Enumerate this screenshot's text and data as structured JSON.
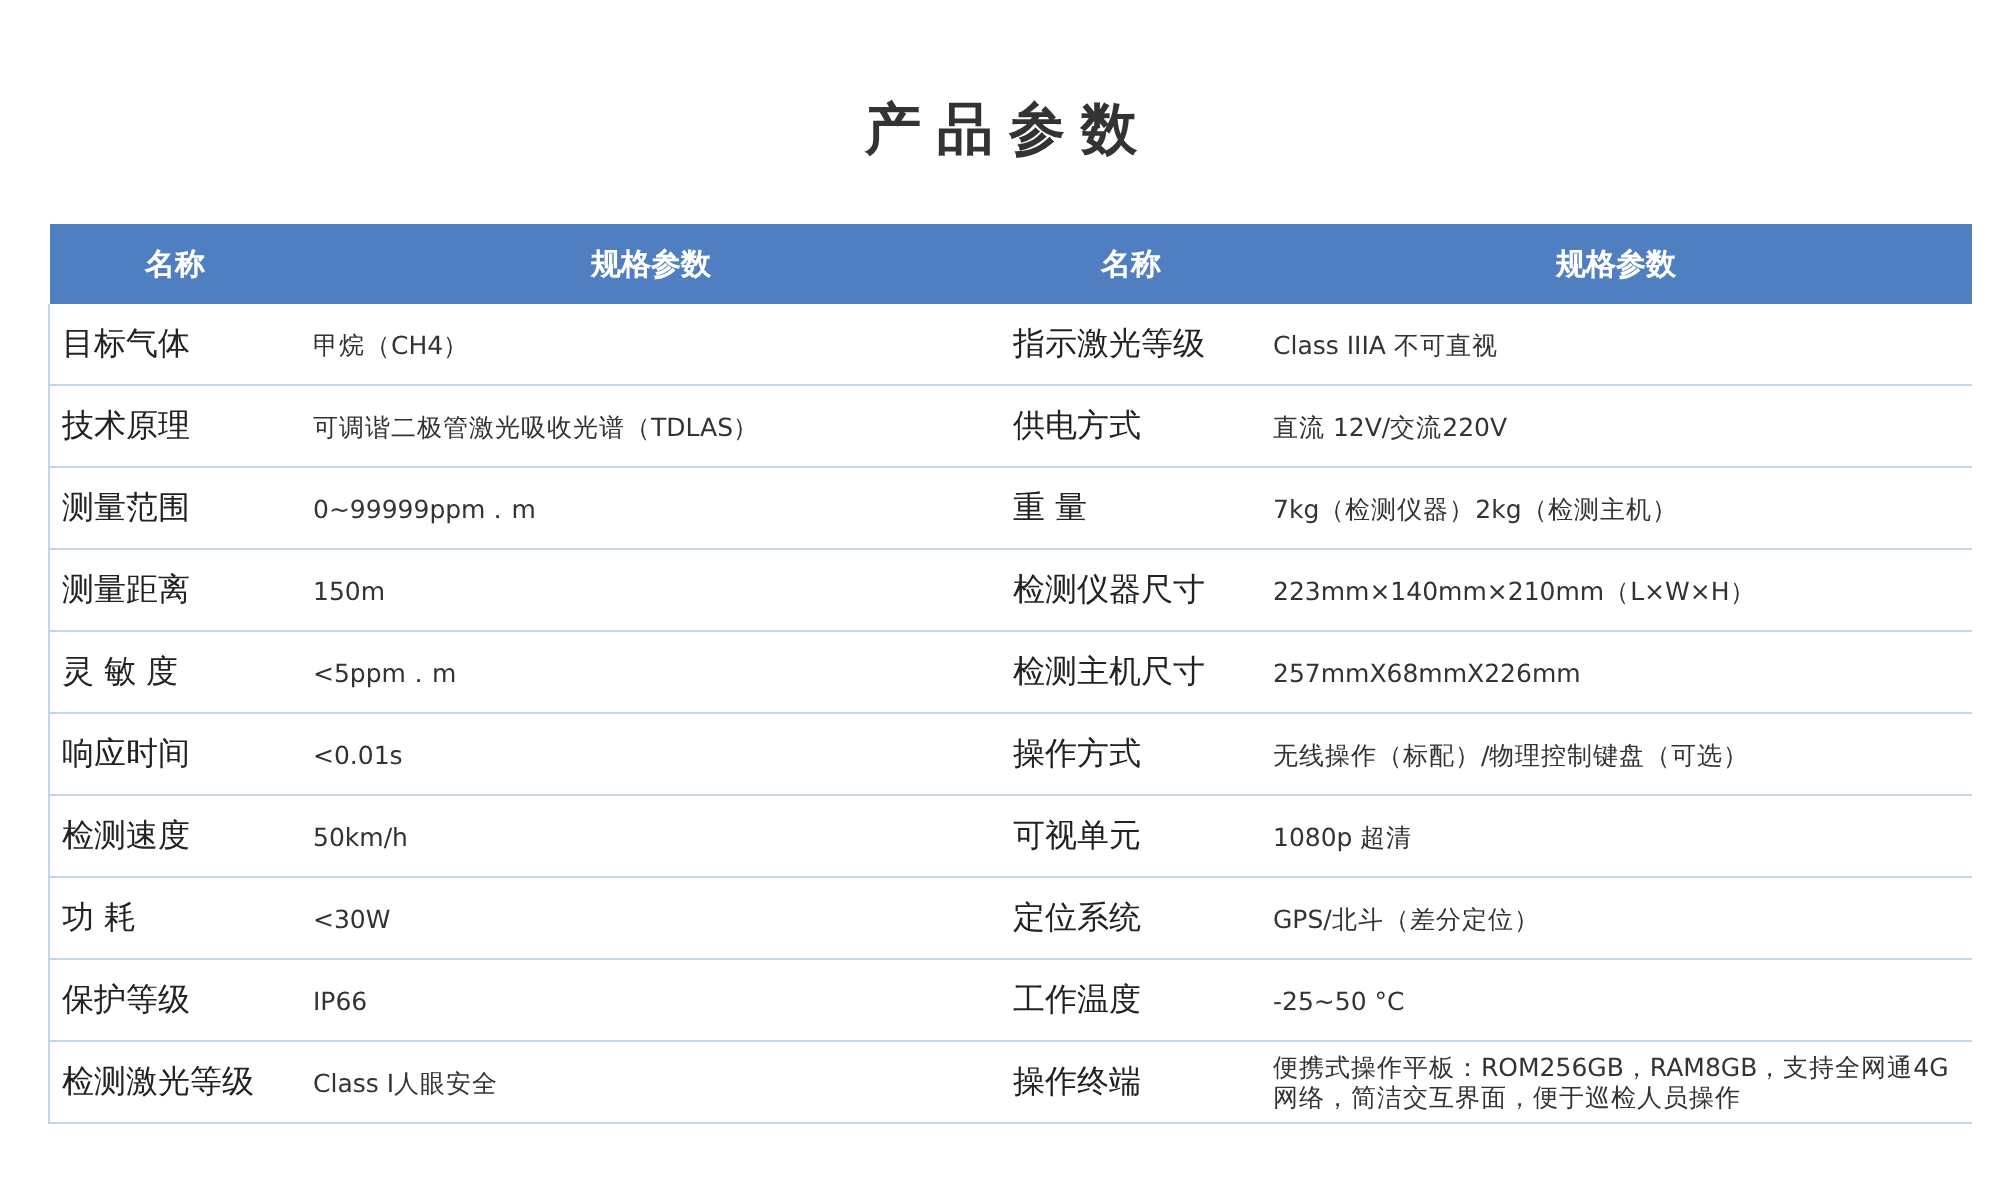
{
  "title": "产品参数",
  "columns": [
    "名称",
    "规格参数",
    "名称",
    "规格参数"
  ],
  "rows": [
    {
      "cells": [
        "目标气体",
        "甲烷（CH4）",
        "指示激光等级",
        "Class IIIA 不可直视"
      ]
    },
    {
      "cells": [
        "技术原理",
        "可调谐二极管激光吸收光谱（TDLAS）",
        "供电方式",
        "直流 12V/交流220V"
      ]
    },
    {
      "cells": [
        "测量范围",
        "0~99999ppm．m",
        "重 量",
        "7kg（检测仪器）2kg（检测主机）"
      ]
    },
    {
      "cells": [
        "测量距离",
        "150m",
        "检测仪器尺寸",
        "223mm×140mm×210mm（L×W×H）"
      ]
    },
    {
      "cells": [
        "灵 敏 度",
        "<5ppm．m",
        "检测主机尺寸",
        "257mmX68mmX226mm"
      ]
    },
    {
      "cells": [
        "响应时间",
        "<0.01s",
        "操作方式",
        "无线操作（标配）/物理控制键盘（可选）"
      ]
    },
    {
      "cells": [
        "检测速度",
        "50km/h",
        "可视单元",
        "1080p 超清"
      ]
    },
    {
      "cells": [
        "功 耗",
        "<30W",
        "定位系统",
        "GPS/北斗（差分定位）"
      ]
    },
    {
      "cells": [
        "保护等级",
        "IP66",
        "工作温度",
        "-25~50 °C"
      ]
    },
    {
      "cells": [
        "检测激光等级",
        "Class I人眼安全",
        "操作终端",
        "便携式操作平板：ROM256GB，RAM8GB，支持全网通4G网络，简洁交互界面，便于巡检人员操作"
      ]
    }
  ]
}
